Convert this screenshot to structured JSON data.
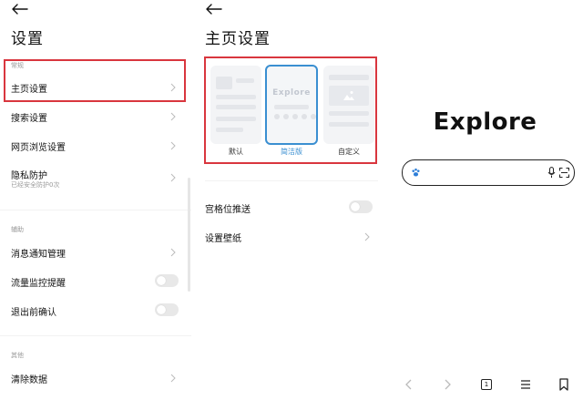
{
  "settings": {
    "title": "设置",
    "section_general": "常规",
    "item_homepage": "主页设置",
    "item_search": "搜索设置",
    "item_browsing": "网页浏览设置",
    "item_privacy": "隐私防护",
    "item_privacy_sub": "已经安全防护0次",
    "section_aux": "辅助",
    "item_notifications": "消息通知管理",
    "item_traffic": "流量监控提醒",
    "item_exit_confirm": "退出前确认",
    "section_other": "其他",
    "item_clear": "清除数据",
    "traffic_toggle_on": false,
    "exit_confirm_toggle_on": false
  },
  "homepage": {
    "title": "主页设置",
    "styles": [
      {
        "label": "默认",
        "selected": false
      },
      {
        "label": "简洁版",
        "selected": true
      },
      {
        "label": "自定义",
        "selected": false
      }
    ],
    "preview_word": "Explore",
    "item_grid_push": "宫格位推送",
    "grid_push_on": false,
    "item_wallpaper": "设置壁纸"
  },
  "preview": {
    "logo": "Explore",
    "nav_icons": [
      "back-icon",
      "forward-icon",
      "tabs-icon",
      "menu-icon",
      "bookmark-icon"
    ],
    "tab_count": "1"
  },
  "colors": {
    "highlight": "#d9363e",
    "accent": "#3a8fd1"
  }
}
